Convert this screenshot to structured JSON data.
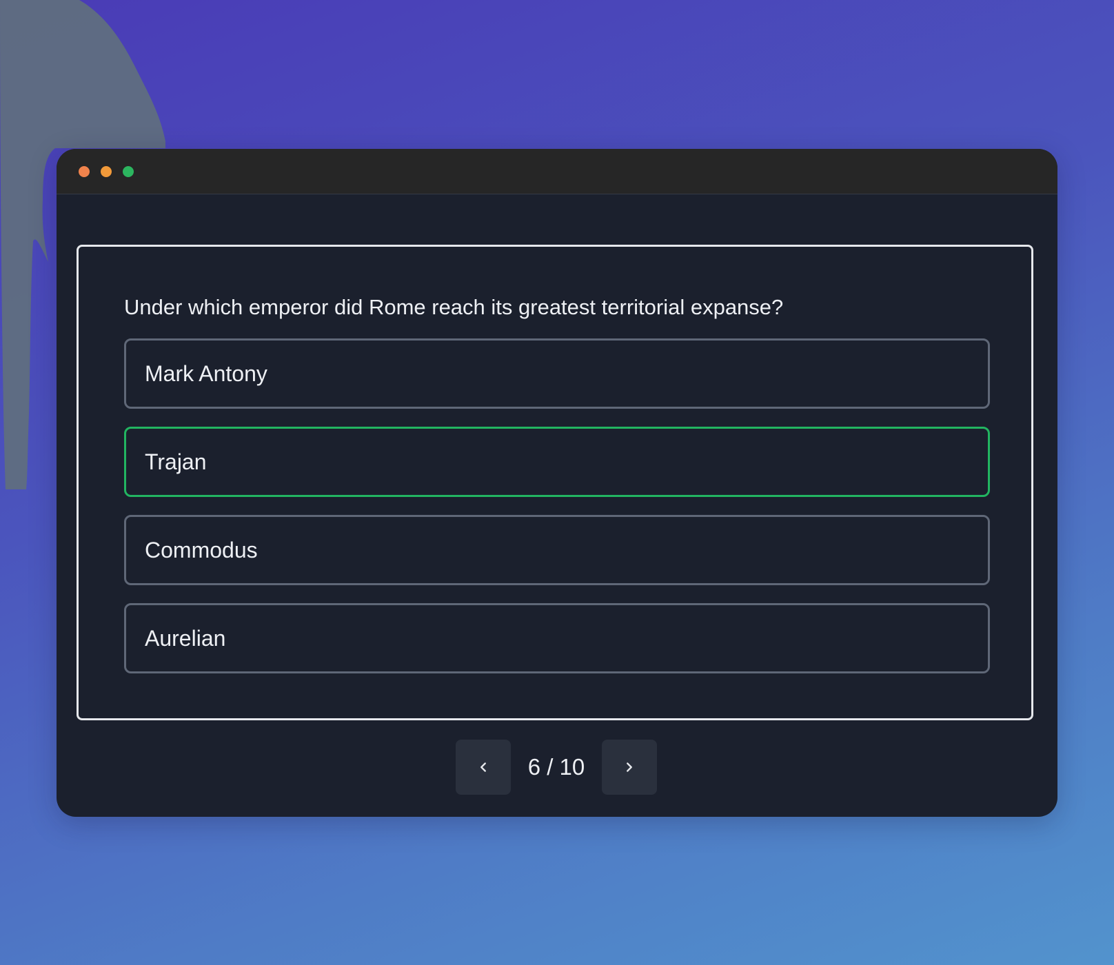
{
  "window": {
    "controls": {
      "close_color": "#f0834c",
      "minimize_color": "#f29a3a",
      "maximize_color": "#2cb55f"
    }
  },
  "quiz": {
    "question": "Under which emperor did Rome reach its greatest territorial expanse?",
    "options": [
      {
        "label": "Mark Antony",
        "selected": false
      },
      {
        "label": "Trajan",
        "selected": true
      },
      {
        "label": "Commodus",
        "selected": false
      },
      {
        "label": "Aurelian",
        "selected": false
      }
    ],
    "selected_color": "#22b561"
  },
  "pager": {
    "current": 6,
    "total": 10,
    "indicator": "6 / 10",
    "prev_icon": "chevron-left-icon",
    "next_icon": "chevron-right-icon"
  }
}
